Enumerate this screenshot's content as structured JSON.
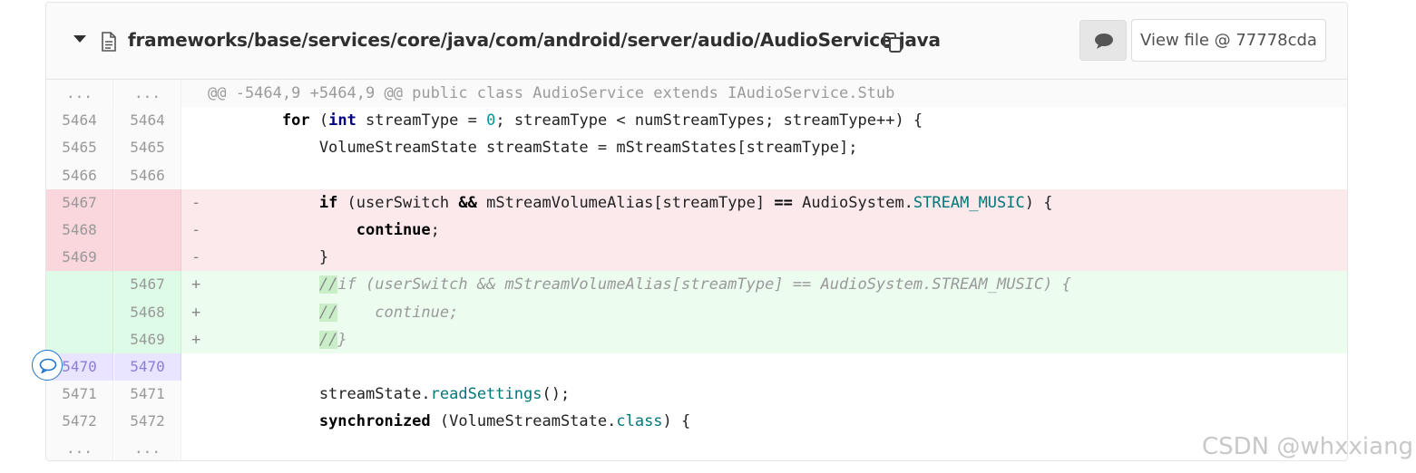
{
  "file": {
    "path": "frameworks/base/services/core/java/com/android/server/audio/AudioService.java",
    "view_file_label": "View file @ 77778cda"
  },
  "rows": [
    {
      "type": "match",
      "old": "...",
      "new": "...",
      "sign": "",
      "text": "@@ -5464,9 +5464,9 @@ public class AudioService extends IAudioService.Stub"
    },
    {
      "type": "ctx",
      "old": "5464",
      "new": "5464",
      "sign": "",
      "text": "        for (int streamType = 0; streamType < numStreamTypes; streamType++) {"
    },
    {
      "type": "ctx",
      "old": "5465",
      "new": "5465",
      "sign": "",
      "text": "            VolumeStreamState streamState = mStreamStates[streamType];"
    },
    {
      "type": "ctx",
      "old": "5466",
      "new": "5466",
      "sign": "",
      "text": ""
    },
    {
      "type": "del",
      "old": "5467",
      "new": "",
      "sign": "-",
      "text": "            if (userSwitch && mStreamVolumeAlias[streamType] == AudioSystem.STREAM_MUSIC) {"
    },
    {
      "type": "del",
      "old": "5468",
      "new": "",
      "sign": "-",
      "text": "                continue;"
    },
    {
      "type": "del",
      "old": "5469",
      "new": "",
      "sign": "-",
      "text": "            }"
    },
    {
      "type": "add",
      "old": "",
      "new": "5467",
      "sign": "+",
      "text": "            //if (userSwitch && mStreamVolumeAlias[streamType] == AudioSystem.STREAM_MUSIC) {"
    },
    {
      "type": "add",
      "old": "",
      "new": "5468",
      "sign": "+",
      "text": "            //    continue;"
    },
    {
      "type": "add",
      "old": "",
      "new": "5469",
      "sign": "+",
      "text": "            //}"
    },
    {
      "type": "hl",
      "old": "5470",
      "new": "5470",
      "sign": "",
      "text": ""
    },
    {
      "type": "ctx",
      "old": "5471",
      "new": "5471",
      "sign": "",
      "text": "            streamState.readSettings();"
    },
    {
      "type": "ctx",
      "old": "5472",
      "new": "5472",
      "sign": "",
      "text": "            synchronized (VolumeStreamState.class) {"
    },
    {
      "type": "ctx",
      "old": "...",
      "new": "...",
      "sign": "",
      "text": ""
    }
  ],
  "watermark": "CSDN @whxxiang",
  "icons": {
    "collapse": "chevron-down-icon",
    "file": "file-icon",
    "copy": "copy-icon",
    "comment": "comment-icon",
    "line_comment": "add-comment-icon"
  },
  "colors": {
    "deleted_line": "#fbe9eb",
    "added_line": "#ecfdf0",
    "highlight_line": "#e9e4ff",
    "accent": "#1f75cb"
  }
}
